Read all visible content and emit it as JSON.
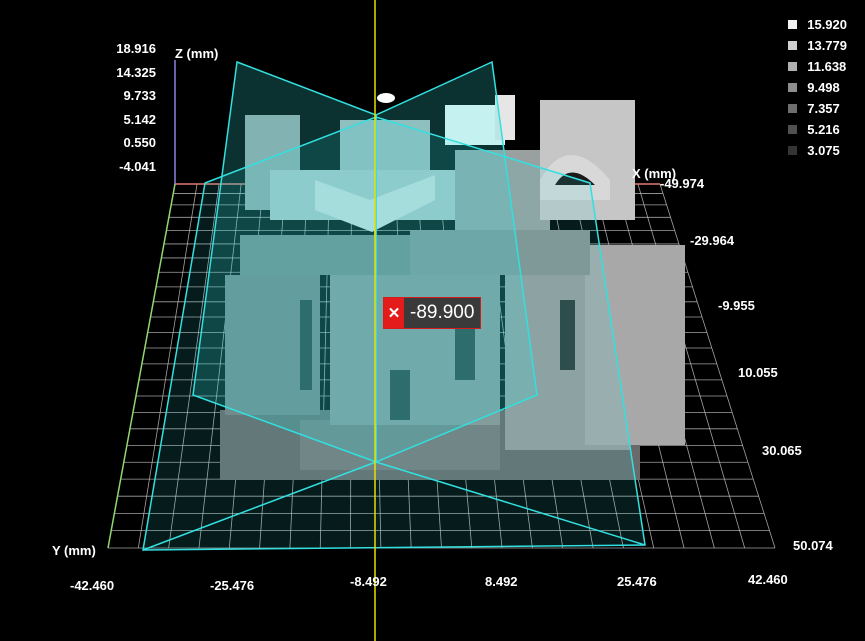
{
  "axes": {
    "z": {
      "title": "Z (mm)",
      "ticks": [
        "18.916",
        "14.325",
        "9.733",
        "5.142",
        "0.550",
        "-4.041"
      ],
      "color": "#8b82e0"
    },
    "x": {
      "title": "X (mm)",
      "ticks": [
        "-42.460",
        "-25.476",
        "-8.492",
        "8.492",
        "25.476",
        "42.460"
      ],
      "color": "#e07b73"
    },
    "y": {
      "title": "Y (mm)",
      "ticks": [
        "-49.974",
        "-29.964",
        "-9.955",
        "10.055",
        "30.065",
        "50.074"
      ],
      "color": "#8fd870"
    }
  },
  "legend": {
    "items": [
      {
        "value": "15.920",
        "color": "#f2f2f2"
      },
      {
        "value": "13.779",
        "color": "#d0d0d0"
      },
      {
        "value": "11.638",
        "color": "#b0b0b0"
      },
      {
        "value": "9.498",
        "color": "#8e8e8e"
      },
      {
        "value": "7.357",
        "color": "#6e6e6e"
      },
      {
        "value": "5.216",
        "color": "#505050"
      },
      {
        "value": "3.075",
        "color": "#343434"
      }
    ]
  },
  "cut_plane": {
    "value": "-89.900",
    "close_icon": "close-icon",
    "color": "#33e0e0"
  },
  "colors": {
    "background": "#000000",
    "grid": "#bfbfbf",
    "crosshair": "#e8e000"
  }
}
